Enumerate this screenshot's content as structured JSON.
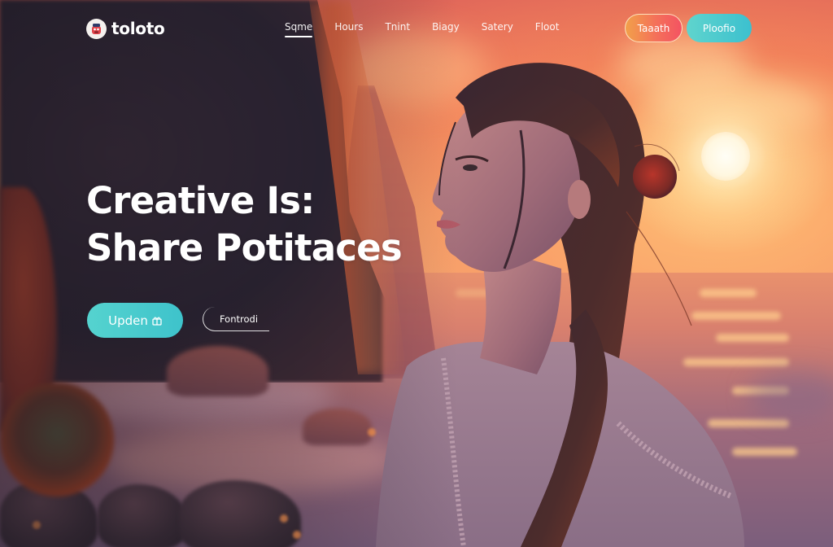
{
  "brand": {
    "name": "toloto",
    "logo_icon": "mascot-logo-icon"
  },
  "nav": {
    "links": [
      {
        "label": "Sqme",
        "active": true
      },
      {
        "label": "Hours",
        "active": false
      },
      {
        "label": "Tnint",
        "active": false
      },
      {
        "label": "Biagy",
        "active": false
      },
      {
        "label": "Satery",
        "active": false
      },
      {
        "label": "Floot",
        "active": false
      }
    ],
    "buttons": {
      "secondary_label": "Taaath",
      "primary_label": "Ploofio"
    }
  },
  "hero": {
    "title_line1": "Creative Is:",
    "title_line2": "Share Potitaces",
    "cta_primary_label": "Upden",
    "cta_primary_icon": "gift-icon",
    "cta_secondary_label": "Fontrodi"
  },
  "colors": {
    "accent_teal": "#47c9cd",
    "accent_orange": "#f2a04a",
    "accent_pink": "#f45362",
    "text": "#ffffff"
  }
}
